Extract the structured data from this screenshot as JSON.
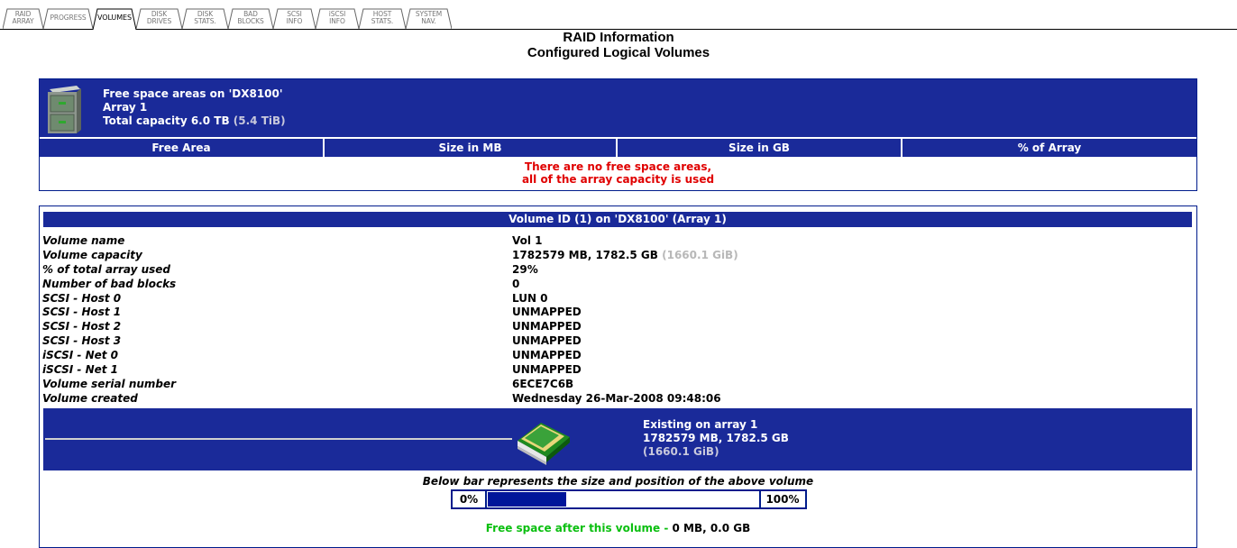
{
  "tabs": [
    {
      "label": "RAID\nARRAY",
      "active": false
    },
    {
      "label": "PROGRESS",
      "active": false
    },
    {
      "label": "VOLUMES",
      "active": true
    },
    {
      "label": "DISK\nDRIVES",
      "active": false
    },
    {
      "label": "DISK\nSTATS.",
      "active": false
    },
    {
      "label": "BAD\nBLOCKS",
      "active": false
    },
    {
      "label": "SCSI\nINFO",
      "active": false
    },
    {
      "label": "iSCSI\nINFO",
      "active": false
    },
    {
      "label": "HOST\nSTATS.",
      "active": false
    },
    {
      "label": "SYSTEM\nNAV.",
      "active": false
    }
  ],
  "title": "RAID Information",
  "subtitle": "Configured Logical Volumes",
  "free_space": {
    "heading": "Free space areas on 'DX8100'",
    "array": "Array 1",
    "capacity_label": "Total capacity 6.0 TB",
    "capacity_tib": "(5.4 TiB)",
    "columns": [
      "Free Area",
      "Size in MB",
      "Size in GB",
      "% of Array"
    ],
    "message_line1": "There are no free space areas,",
    "message_line2": "all of the array capacity is used"
  },
  "volume": {
    "header": "Volume ID (1) on 'DX8100' (Array 1)",
    "properties": [
      {
        "key": "Volume name",
        "value": "Vol 1",
        "extra": ""
      },
      {
        "key": "Volume capacity",
        "value": "1782579 MB, 1782.5 GB",
        "extra": "(1660.1 GiB)"
      },
      {
        "key": "% of total array used",
        "value": "29%",
        "extra": ""
      },
      {
        "key": "Number of bad blocks",
        "value": "0",
        "extra": ""
      },
      {
        "key": "SCSI - Host 0",
        "value": "LUN 0",
        "extra": ""
      },
      {
        "key": "SCSI - Host 1",
        "value": "UNMAPPED",
        "extra": ""
      },
      {
        "key": "SCSI - Host 2",
        "value": "UNMAPPED",
        "extra": ""
      },
      {
        "key": "SCSI - Host 3",
        "value": "UNMAPPED",
        "extra": ""
      },
      {
        "key": "iSCSI - Net 0",
        "value": "UNMAPPED",
        "extra": ""
      },
      {
        "key": "iSCSI - Net 1",
        "value": "UNMAPPED",
        "extra": ""
      },
      {
        "key": "Volume serial number",
        "value": "6ECE7C6B",
        "extra": ""
      },
      {
        "key": "Volume created",
        "value": "Wednesday 26-Mar-2008 09:48:06",
        "extra": ""
      }
    ],
    "existing_line1": "Existing on array 1",
    "existing_line2": "1782579 MB, 1782.5 GB",
    "existing_line3": "(1660.1 GiB)",
    "bar_caption": "Below bar represents the size and position of the above volume",
    "bar_start_label": "0%",
    "bar_end_label": "100%",
    "bar_fill_fraction": 0.29,
    "free_after_label": "Free space after this volume - ",
    "free_after_value": "0 MB, 0.0 GB"
  },
  "colors": {
    "header_blue": "#1a2a99",
    "bar_blue": "#00159a",
    "error_red": "#e00000",
    "free_green": "#0bbf10"
  }
}
